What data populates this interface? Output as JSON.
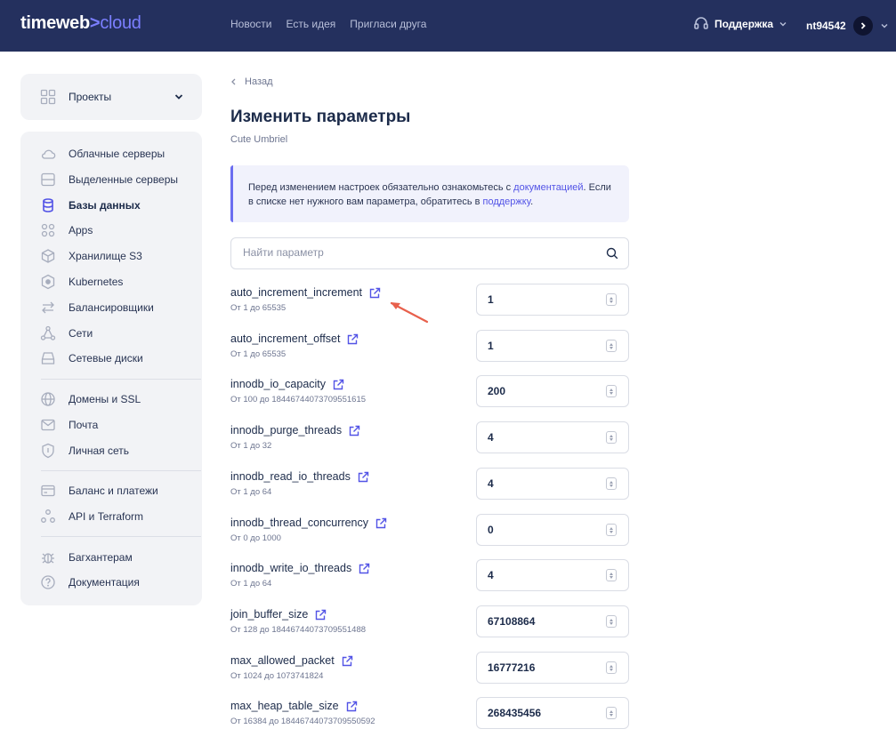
{
  "header": {
    "logo_main": "timeweb",
    "logo_sep": ">",
    "logo_cloud": "cloud",
    "nav": [
      "Новости",
      "Есть идея",
      "Пригласи друга"
    ],
    "support": "Поддержка",
    "user": "nt94542"
  },
  "sidebar": {
    "projects": "Проекты",
    "items": [
      {
        "label": "Облачные серверы",
        "icon": "cloud-icon"
      },
      {
        "label": "Выделенные серверы",
        "icon": "server-icon"
      },
      {
        "label": "Базы данных",
        "icon": "database-icon",
        "active": true
      },
      {
        "label": "Apps",
        "icon": "apps-icon"
      },
      {
        "label": "Хранилище S3",
        "icon": "storage-icon"
      },
      {
        "label": "Kubernetes",
        "icon": "kubernetes-icon"
      },
      {
        "label": "Балансировщики",
        "icon": "balancer-icon"
      },
      {
        "label": "Сети",
        "icon": "network-icon"
      },
      {
        "label": "Сетевые диски",
        "icon": "disk-icon"
      },
      {
        "label": "Домены и SSL",
        "icon": "globe-icon"
      },
      {
        "label": "Почта",
        "icon": "mail-icon"
      },
      {
        "label": "Личная сеть",
        "icon": "shield-icon"
      },
      {
        "label": "Баланс и платежи",
        "icon": "wallet-icon"
      },
      {
        "label": "API и Terraform",
        "icon": "api-icon"
      },
      {
        "label": "Багхантерам",
        "icon": "bug-icon"
      },
      {
        "label": "Документация",
        "icon": "help-icon"
      }
    ]
  },
  "main": {
    "back": "Назад",
    "title": "Изменить параметры",
    "subtitle": "Cute Umbriel",
    "notice": {
      "text1": "Перед изменением настроек обязательно ознакомьтесь с ",
      "link1": "документацией",
      "text2": ". Если в списке нет нужного вам параметра, обратитесь в ",
      "link2": "поддержку",
      "text3": "."
    },
    "search_placeholder": "Найти параметр",
    "params": [
      {
        "name": "auto_increment_increment",
        "range": "От 1 до 65535",
        "value": "1"
      },
      {
        "name": "auto_increment_offset",
        "range": "От 1 до 65535",
        "value": "1"
      },
      {
        "name": "innodb_io_capacity",
        "range": "От 100 до 18446744073709551615",
        "value": "200"
      },
      {
        "name": "innodb_purge_threads",
        "range": "От 1 до 32",
        "value": "4"
      },
      {
        "name": "innodb_read_io_threads",
        "range": "От 1 до 64",
        "value": "4"
      },
      {
        "name": "innodb_thread_concurrency",
        "range": "От 0 до 1000",
        "value": "0"
      },
      {
        "name": "innodb_write_io_threads",
        "range": "От 1 до 64",
        "value": "4"
      },
      {
        "name": "join_buffer_size",
        "range": "От 128 до 18446744073709551488",
        "value": "67108864"
      },
      {
        "name": "max_allowed_packet",
        "range": "От 1024 до 1073741824",
        "value": "16777216"
      },
      {
        "name": "max_heap_table_size",
        "range": "От 16384 до 18446744073709550592",
        "value": "268435456"
      }
    ]
  },
  "colors": {
    "header_bg": "#24305e",
    "accent": "#6b6df0",
    "annotation_arrow": "#e8604c"
  }
}
